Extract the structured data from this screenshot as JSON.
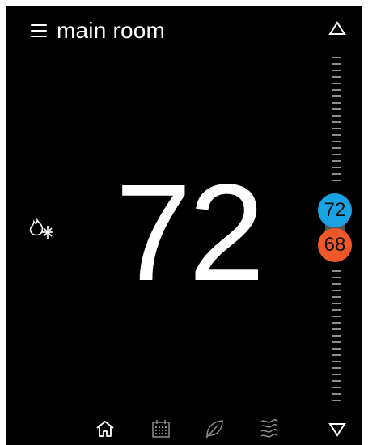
{
  "header": {
    "title": "main room",
    "menu_icon": "hamburger-menu-icon"
  },
  "temperature": {
    "current": "72"
  },
  "setpoints": {
    "cool": "72",
    "heat": "68"
  },
  "controls": {
    "up_icon": "triangle-up-icon",
    "down_icon": "triangle-down-icon",
    "mode_icon": "flame-snowflake-icon"
  },
  "nav": [
    {
      "icon": "home-icon"
    },
    {
      "icon": "calendar-icon"
    },
    {
      "icon": "leaf-icon"
    },
    {
      "icon": "wavy-lines-icon"
    }
  ],
  "colors": {
    "background": "#000000",
    "cool": "#1aa3e4",
    "heat": "#f0582a",
    "scale_tick": "#8d8d8d"
  }
}
